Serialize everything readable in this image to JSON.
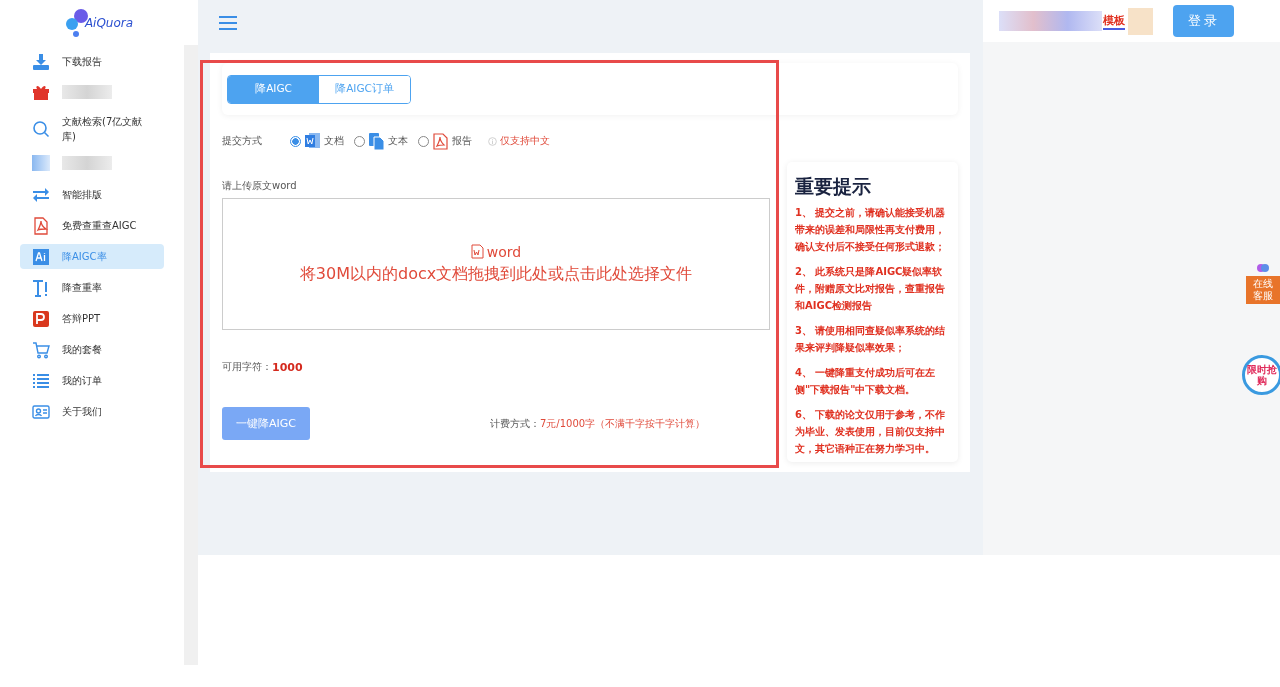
{
  "logo": {
    "text": "AiQuora"
  },
  "nav": [
    {
      "kind": "item",
      "label": "下载报告",
      "selected": false
    },
    {
      "kind": "blurred"
    },
    {
      "kind": "item",
      "label": "文献检索(7亿文献库)",
      "selected": false
    },
    {
      "kind": "blurred"
    },
    {
      "kind": "item",
      "label": "智能排版",
      "selected": false
    },
    {
      "kind": "item",
      "label": "免费查重查AIGC",
      "selected": false
    },
    {
      "kind": "item",
      "label": "降AIGC率",
      "selected": true
    },
    {
      "kind": "item",
      "label": "降查重率",
      "selected": false
    },
    {
      "kind": "item",
      "label": "答辩PPT",
      "selected": false
    },
    {
      "kind": "item",
      "label": "我的套餐",
      "selected": false
    },
    {
      "kind": "item",
      "label": "我的订单",
      "selected": false
    },
    {
      "kind": "item",
      "label": "关于我们",
      "selected": false
    }
  ],
  "header": {
    "banner_link": "模板",
    "login": "登录"
  },
  "tabs": [
    {
      "label": "降AIGC",
      "selected": true
    },
    {
      "label": "降AIGC订单",
      "selected": false
    }
  ],
  "submit": {
    "label": "提交方式",
    "note": "仅支持中文",
    "options": [
      {
        "label": "文档",
        "selected": true
      },
      {
        "label": "文本",
        "selected": false
      },
      {
        "label": "报告",
        "selected": false
      }
    ]
  },
  "upload": {
    "label": "请上传原文word",
    "icon_label": "word",
    "hint": "将30M以内的docx文档拖拽到此处或点击此处选择文件"
  },
  "available": {
    "label": "可用字符：",
    "value": "1000"
  },
  "action": {
    "button": "一键降AIGC",
    "price_label": "计费方式：",
    "price": "7元/1000字（不满千字按千字计算）"
  },
  "tips": {
    "title": "重要提示",
    "items": [
      "1、 提交之前，请确认能接受机器带来的误差和局限性再支付费用，确认支付后不接受任何形式退款；",
      "2、 此系统只是降AIGC疑似率软件，附赠原文比对报告，查重报告和AIGC检测报告",
      "3、 请使用相同查疑似率系统的结果来评判降疑似率效果；",
      "4、 一键降重支付成功后可在左侧\"下载报告\"中下载文档。",
      "6、 下载的论文仅用于参考，不作为毕业、发表使用，目前仅支持中文，其它语种正在努力学习中。"
    ]
  },
  "floating": {
    "service": "在线客服",
    "flash": "限时抢购"
  }
}
